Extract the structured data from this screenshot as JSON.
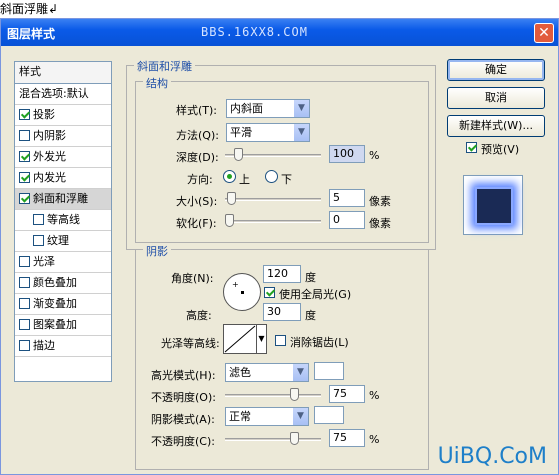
{
  "doc_title": "斜面浮雕↲",
  "window": {
    "title": "图层样式",
    "watermark": "BBS.16XX8.COM"
  },
  "sidebar": {
    "items": [
      {
        "label": "样式",
        "checkbox": false,
        "checked": false
      },
      {
        "label": "混合选项:默认",
        "checkbox": false,
        "checked": false
      },
      {
        "label": "投影",
        "checkbox": true,
        "checked": true
      },
      {
        "label": "内阴影",
        "checkbox": true,
        "checked": false
      },
      {
        "label": "外发光",
        "checkbox": true,
        "checked": true
      },
      {
        "label": "内发光",
        "checkbox": true,
        "checked": true
      },
      {
        "label": "斜面和浮雕",
        "checkbox": true,
        "checked": true
      },
      {
        "label": "等高线",
        "checkbox": true,
        "checked": false
      },
      {
        "label": "纹理",
        "checkbox": true,
        "checked": false
      },
      {
        "label": "光泽",
        "checkbox": true,
        "checked": false
      },
      {
        "label": "颜色叠加",
        "checkbox": true,
        "checked": false
      },
      {
        "label": "渐变叠加",
        "checkbox": true,
        "checked": false
      },
      {
        "label": "图案叠加",
        "checkbox": true,
        "checked": false
      },
      {
        "label": "描边",
        "checkbox": true,
        "checked": false
      }
    ]
  },
  "bevel": {
    "group_title": "斜面和浮雕",
    "structure_title": "结构",
    "style_label": "样式(T):",
    "style_value": "内斜面",
    "method_label": "方法(Q):",
    "method_value": "平滑",
    "depth_label": "深度(D):",
    "depth_value": "100",
    "depth_unit": "%",
    "depth_slider": 0.1,
    "direction_label": "方向:",
    "dir_up": "上",
    "dir_down": "下",
    "size_label": "大小(S):",
    "size_value": "5",
    "size_unit": "像素",
    "size_slider": 0.02,
    "soften_label": "软化(F):",
    "soften_value": "0",
    "soften_unit": "像素",
    "soften_slider": 0.0
  },
  "shading": {
    "title": "阴影",
    "angle_label": "角度(N):",
    "angle_value": "120",
    "angle_unit": "度",
    "global_light_label": "使用全局光(G)",
    "altitude_label": "高度:",
    "altitude_value": "30",
    "altitude_unit": "度",
    "gloss_label": "光泽等高线:",
    "antialias_label": "消除锯齿(L)",
    "highlight_mode_label": "高光模式(H):",
    "highlight_mode_value": "滤色",
    "highlight_opacity_label": "不透明度(O):",
    "highlight_opacity_value": "75",
    "highlight_opacity_unit": "%",
    "highlight_slider": 0.75,
    "shadow_mode_label": "阴影模式(A):",
    "shadow_mode_value": "正常",
    "shadow_opacity_label": "不透明度(C):",
    "shadow_opacity_value": "75",
    "shadow_opacity_unit": "%",
    "shadow_slider": 0.75
  },
  "buttons": {
    "ok": "确定",
    "cancel": "取消",
    "new_style": "新建样式(W)...",
    "preview": "预览(V)"
  },
  "brand_watermark": "UiBQ.CoM"
}
